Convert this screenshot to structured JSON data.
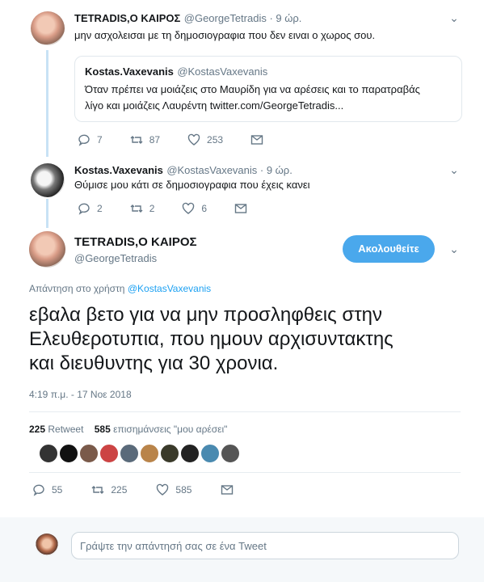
{
  "tweet1": {
    "name": "TETRADIS,Ο ΚΑΙΡΟΣ",
    "handle": "@GeorgeTetradis · 9 ώρ.",
    "text": "μην ασχολεισαι με τη δημοσιογραφια που δεν ειναι ο χωρος σου.",
    "quote": {
      "name": "Kostas.Vaxevanis",
      "handle": "@KostasVaxevanis",
      "line1": "Όταν πρέπει να μοιάζεις στο Μαυρίδη για να αρέσεις και το παρατραβάς",
      "line2": "λίγο και μοιάζεις Λαυρέντη twitter.com/GeorgeTetradis..."
    },
    "replies": "7",
    "retweets": "87",
    "likes": "253"
  },
  "tweet2": {
    "name": "Kostas.Vaxevanis",
    "handle": "@KostasVaxevanis · 9 ώρ.",
    "text": "Θύμισε μου κάτι σε δημοσιογραφια που έχεις κανει",
    "replies": "2",
    "retweets": "2",
    "likes": "6"
  },
  "main": {
    "name": "TETRADIS,Ο ΚΑΙΡΟΣ",
    "handle": "@GeorgeTetradis",
    "follow_label": "Ακολουθείτε",
    "reply_to_prefix": "Απάντηση στο χρήστη",
    "reply_to_user": "@KostasVaxevanis",
    "text_line1": "εβαλα βετο για να μην προσληφθεις στην",
    "text_line2": "Ελευθεροτυπια, που ημουν αρχισυντακτης",
    "text_line3": "και διευθυντης για 30 χρονια.",
    "timestamp": "4:19 π.μ. - 17 Νοε 2018",
    "retweet_count": "225",
    "retweet_label": "Retweet",
    "like_count": "585",
    "like_label": "επισημάνσεις \"μου αρέσει\"",
    "replies": "55",
    "retweets": "225",
    "likes": "585"
  },
  "reply_box": {
    "placeholder": "Γράψτε την απάντησή σας σε ένα Tweet"
  },
  "colors": {
    "accent": "#4aa8ec",
    "thread_line": "#c8e2f5",
    "muted": "#657786"
  }
}
